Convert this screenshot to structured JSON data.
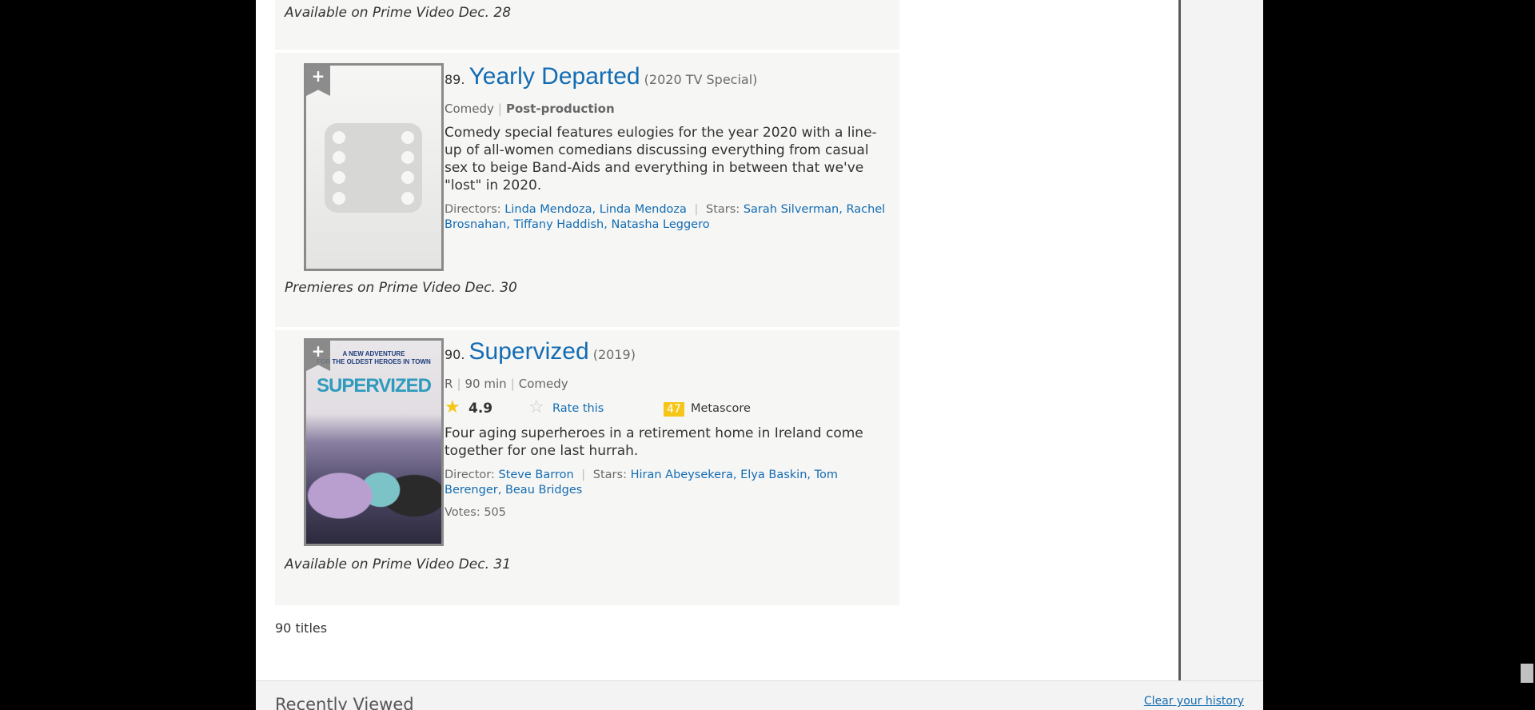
{
  "prev_item": {
    "availability": "Available on Prime Video Dec. 28"
  },
  "items": [
    {
      "rank": "89.",
      "title": "Yearly Departed",
      "year": "(2020 TV Special)",
      "genre": "Comedy",
      "status": "Post-production",
      "plot": "Comedy special features eulogies for the year 2020 with a line-up of all-women comedians discussing everything from casual sex to beige Band-Aids and everything in between that we've \"lost\" in 2020.",
      "directors_label": "Directors:",
      "directors": [
        "Linda Mendoza,",
        "Linda Mendoza"
      ],
      "stars_label": "Stars:",
      "stars": [
        "Sarah Silverman,",
        "Rachel Brosnahan,",
        "Tiffany Haddish,",
        "Natasha Leggero"
      ],
      "availability": "Premieres on Prime Video Dec. 30",
      "watchlist_icon": "+",
      "poster_icon": "film-placeholder-icon"
    },
    {
      "rank": "90.",
      "title": "Supervized",
      "year": "(2019)",
      "certificate": "R",
      "runtime": "90 min",
      "genre": "Comedy",
      "rating": "4.9",
      "rate_label": "Rate this",
      "metascore": "47",
      "metascore_label": "Metascore",
      "plot": "Four aging superheroes in a retirement home in Ireland come together for one last hurrah.",
      "directors_label": "Director:",
      "directors": [
        "Steve Barron"
      ],
      "stars_label": "Stars:",
      "stars": [
        "Hiran Abeysekera,",
        "Elya Baskin,",
        "Tom Berenger,",
        "Beau Bridges"
      ],
      "votes_label": "Votes:",
      "votes": "505",
      "availability": "Available on Prime Video Dec. 31",
      "watchlist_icon": "+",
      "poster_tagline": "A NEW ADVENTURE\nFOR THE OLDEST HEROES IN TOWN",
      "poster_logo": "SUPERVIZED"
    }
  ],
  "summary": {
    "count_text": "90 titles"
  },
  "recently_viewed": {
    "heading": "Recently Viewed",
    "clear_link": "Clear your history"
  },
  "colors": {
    "link": "#136cb2",
    "metascore_bg": "#f5c518",
    "star": "#f5c518"
  }
}
